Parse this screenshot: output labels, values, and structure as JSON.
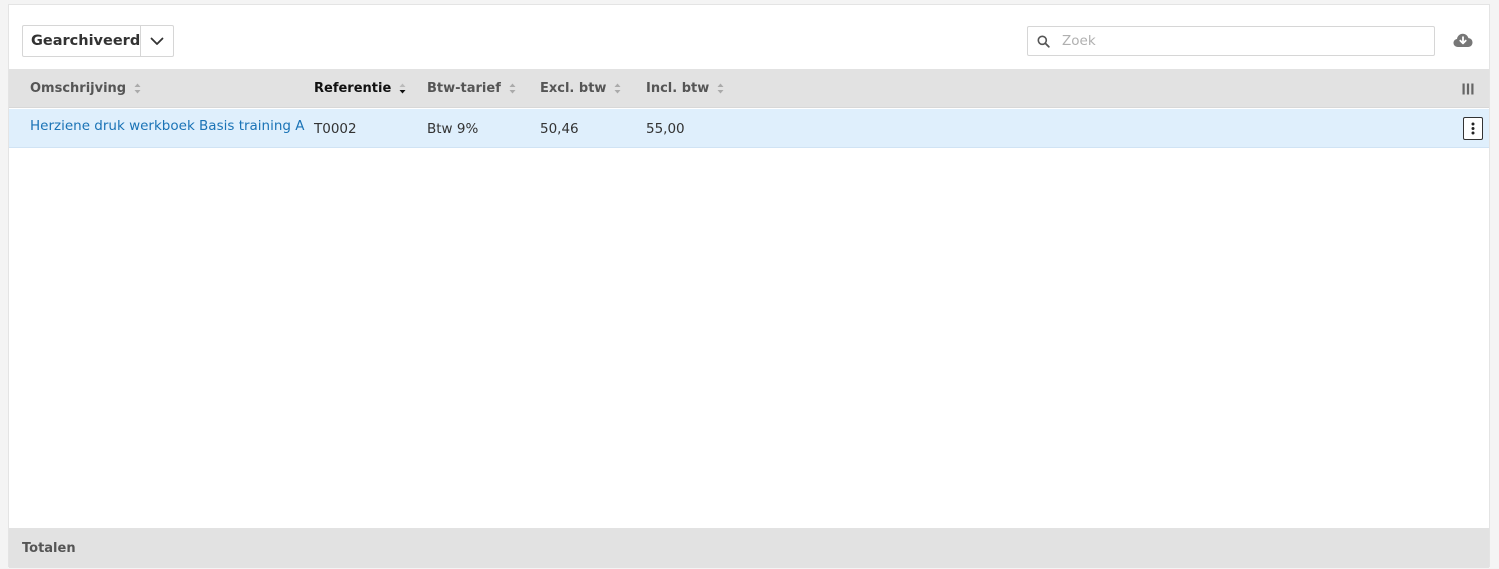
{
  "toolbar": {
    "filter_label": "Gearchiveerd",
    "search_placeholder": "Zoek",
    "search_value": ""
  },
  "table": {
    "columns": [
      {
        "label": "Omschrijving",
        "sorted": false
      },
      {
        "label": "Referentie",
        "sorted": true,
        "direction": "desc"
      },
      {
        "label": "Btw-tarief",
        "sorted": false
      },
      {
        "label": "Excl. btw",
        "sorted": false
      },
      {
        "label": "Incl. btw",
        "sorted": false
      }
    ],
    "rows": [
      {
        "omschrijving": "Herziene druk werkboek Basis training A",
        "referentie": "T0002",
        "btw_tarief": "Btw 9%",
        "excl_btw": "50,46",
        "incl_btw": "55,00",
        "selected": true
      }
    ]
  },
  "footer": {
    "label": "Totalen"
  },
  "icons": {
    "filter_toggle": "chevron-down-icon",
    "search": "search-icon",
    "download": "cloud-download-icon",
    "columns": "columns-icon",
    "row_menu": "more-vertical-icon"
  },
  "colors": {
    "link": "#1a73b6",
    "selected_row": "#dfeffc",
    "header_bg": "#e2e2e2"
  }
}
